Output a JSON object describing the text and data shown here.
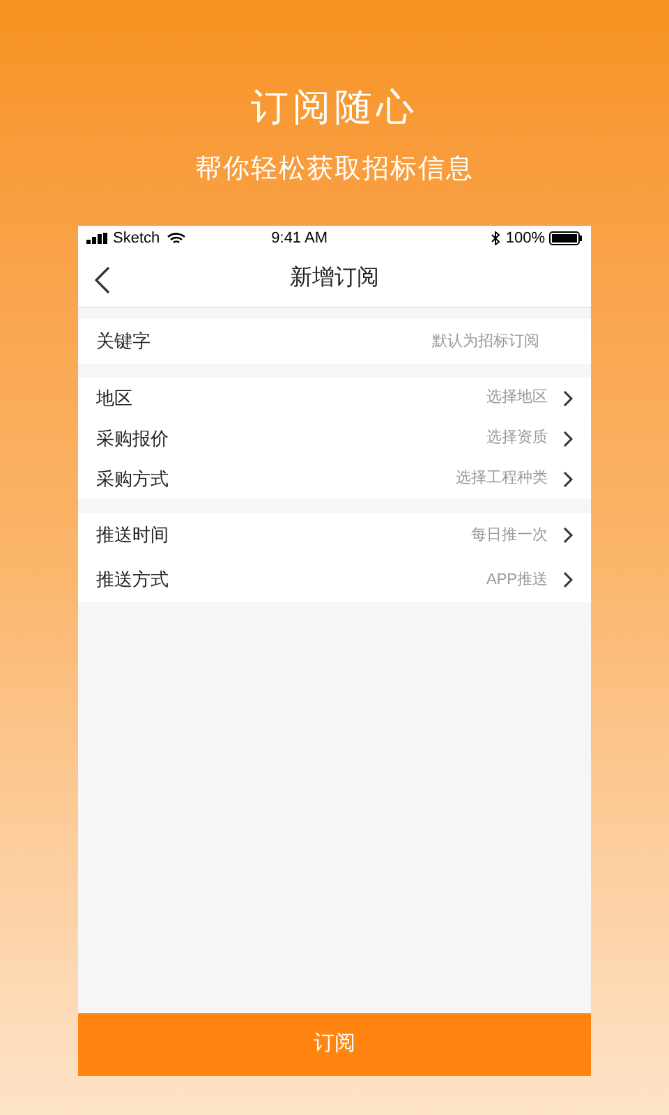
{
  "banner": {
    "title": "订阅随心",
    "subtitle": "帮你轻松获取招标信息"
  },
  "status_bar": {
    "carrier": "Sketch",
    "time": "9:41 AM",
    "battery": "100%"
  },
  "nav": {
    "title": "新增订阅"
  },
  "sections": [
    {
      "rows": [
        {
          "kind": "input",
          "label": "关键字",
          "placeholder": "默认为招标订阅"
        }
      ]
    },
    {
      "rows": [
        {
          "kind": "select",
          "label": "地区",
          "value": "选择地区"
        },
        {
          "kind": "select",
          "label": "采购报价",
          "value": "选择资质"
        },
        {
          "kind": "select",
          "label": "采购方式",
          "value": "选择工程种类"
        }
      ]
    },
    {
      "rows": [
        {
          "kind": "select",
          "label": "推送时间",
          "value": "每日推一次"
        },
        {
          "kind": "select",
          "label": "推送方式",
          "value": "APP推送"
        }
      ]
    }
  ],
  "submit_button": "订阅"
}
